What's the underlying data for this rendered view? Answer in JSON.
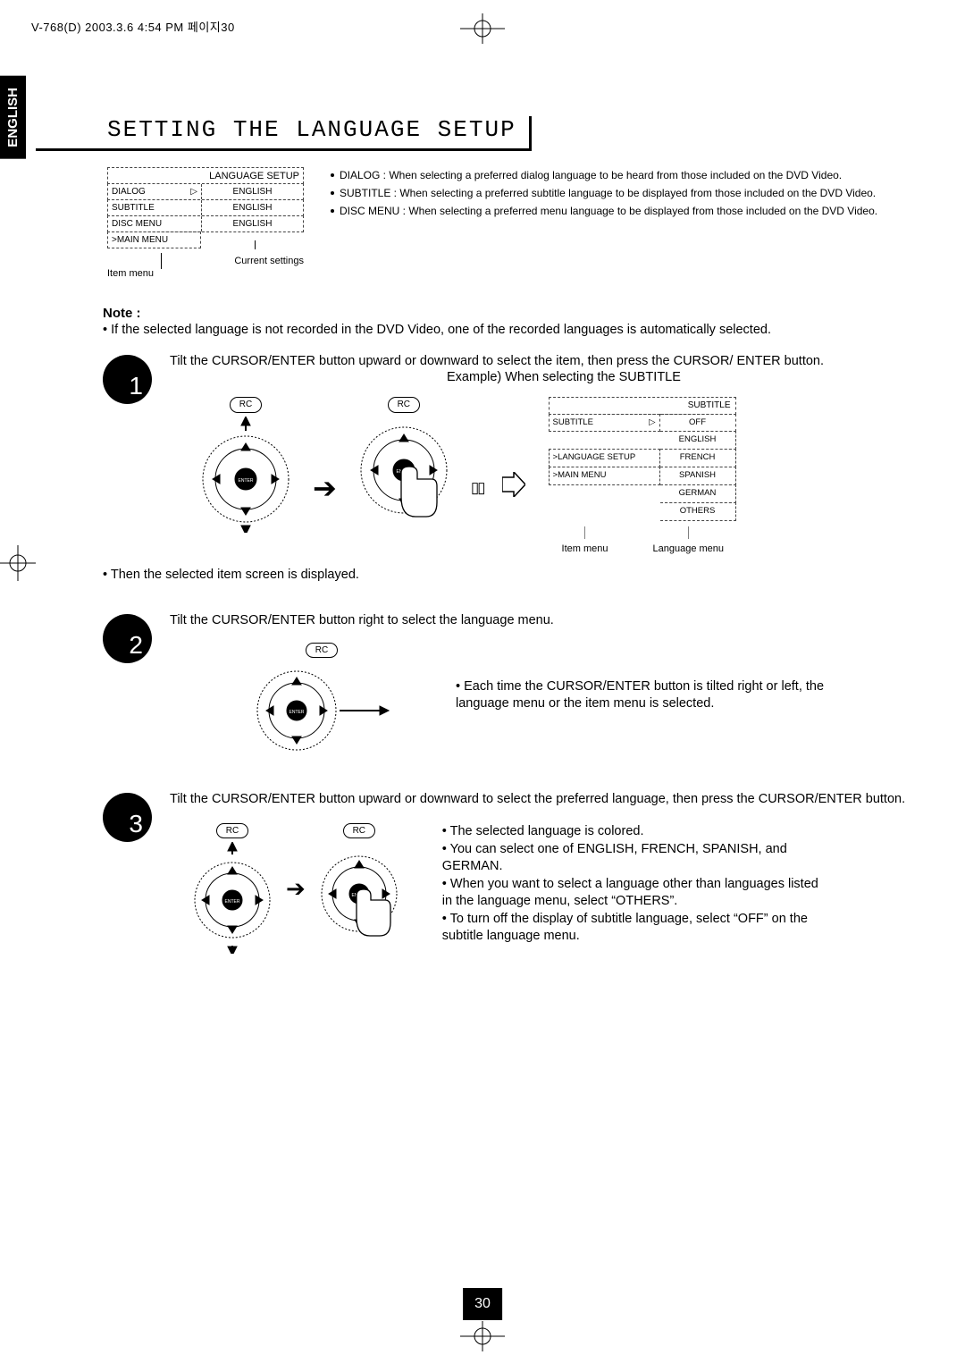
{
  "header": "V-768(D)  2003.3.6 4:54 PM  페이지30",
  "section_title": "SETTING THE LANGUAGE SETUP",
  "side_tab": "ENGLISH",
  "lang_setup": {
    "title": "LANGUAGE SETUP",
    "rows": [
      {
        "l": "DIALOG",
        "mark": "▷",
        "r": "ENGLISH"
      },
      {
        "l": "SUBTITLE",
        "mark": "",
        "r": "ENGLISH"
      },
      {
        "l": "DISC MENU",
        "mark": "",
        "r": "ENGLISH"
      }
    ],
    "last": ">MAIN MENU",
    "cap_left": "Item menu",
    "cap_right": "Current settings"
  },
  "intro_bullets": [
    "DIALOG : When selecting a preferred dialog language to be heard from those included on the DVD Video.",
    "SUBTITLE : When selecting a preferred subtitle language to be displayed from those included on the DVD Video.",
    "DISC MENU : When selecting a preferred menu language to be displayed from those included on the DVD Video."
  ],
  "note": {
    "hd": "Note :",
    "body": "• If the selected language is not recorded in the DVD Video, one of the recorded languages is automatically selected."
  },
  "step1": {
    "num": "1",
    "text": "Tilt the CURSOR/ENTER button upward or downward to select the item, then press the CURSOR/ ENTER button.",
    "example": "Example) When selecting the SUBTITLE",
    "rc": "RC",
    "subtitle_box": {
      "title": "SUBTITLE",
      "row1": {
        "l": "SUBTITLE",
        "mark": "▷",
        "r": "OFF"
      },
      "options": [
        "ENGLISH",
        "FRENCH",
        "SPANISH",
        "GERMAN",
        "OTHERS"
      ],
      "back1": ">LANGUAGE SETUP",
      "back2": ">MAIN MENU",
      "cap_l": "Item menu",
      "cap_r": "Language menu"
    }
  },
  "after1": "• Then the selected item screen is displayed.",
  "step2": {
    "num": "2",
    "text": "Tilt the CURSOR/ENTER button right to select the language menu.",
    "rc": "RC",
    "side": "• Each time the CURSOR/ENTER button is tilted right or left, the language menu or the item menu is selected."
  },
  "step3": {
    "num": "3",
    "text": "Tilt the CURSOR/ENTER button upward or downward to select the preferred language, then press the CURSOR/ENTER button.",
    "rc": "RC",
    "bullets": [
      "The selected language is colored.",
      "You can select one of ENGLISH, FRENCH, SPANISH, and GERMAN.",
      "When you want to select a language other than languages listed in the language menu, select “OTHERS”.",
      "To turn off the display of subtitle language, select “OFF” on the subtitle language menu."
    ]
  },
  "page_number": "30",
  "enter": "ENTER"
}
